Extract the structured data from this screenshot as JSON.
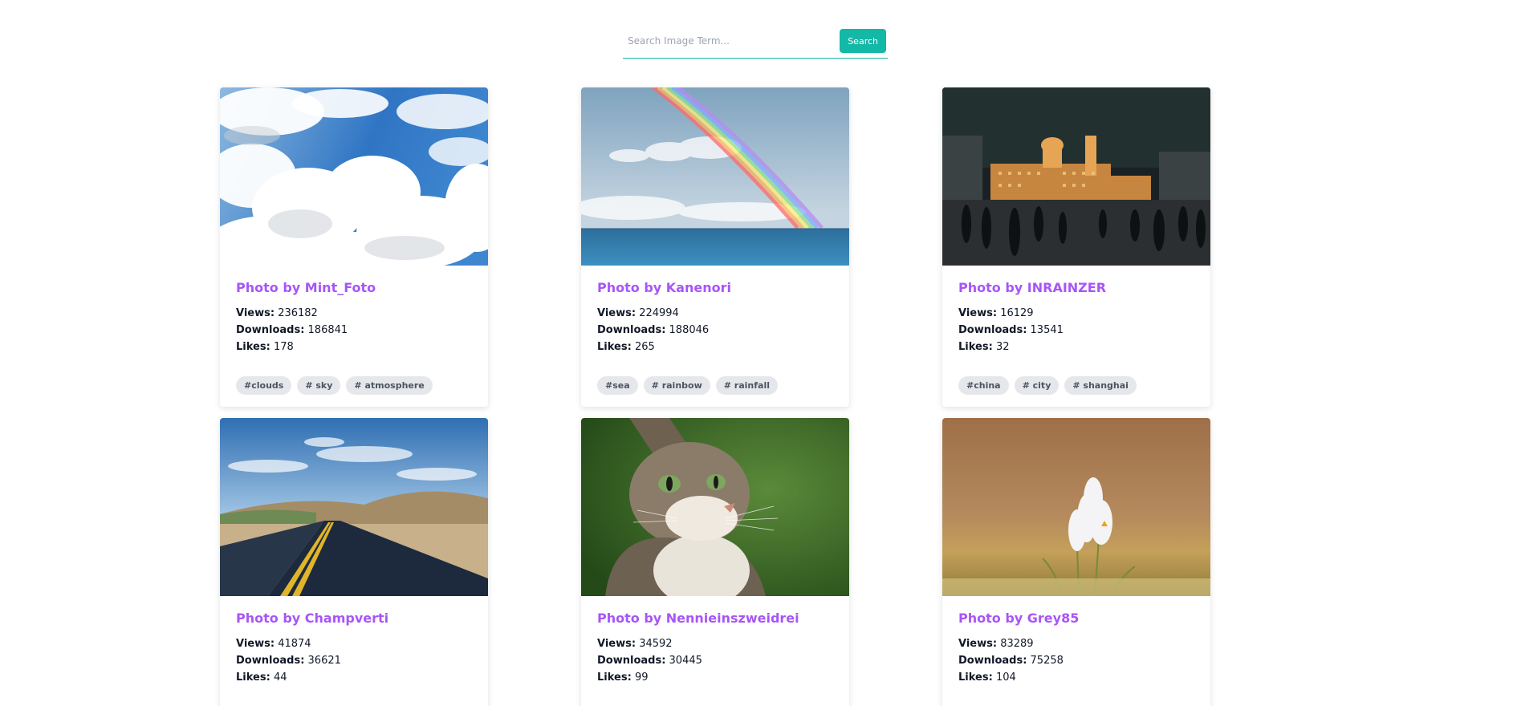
{
  "search": {
    "placeholder": "Search Image Term...",
    "button_label": "Search"
  },
  "colors": {
    "accent": "#14b8a6",
    "title": "#a855f7",
    "tag_bg": "#e5e7eb"
  },
  "stat_labels": {
    "views": "Views:",
    "downloads": "Downloads:",
    "likes": "Likes:"
  },
  "cards": [
    {
      "title": "Photo by Mint_Foto",
      "image": "clouds-sky",
      "views": "236182",
      "downloads": "186841",
      "likes": "178",
      "tags": [
        "#clouds",
        "# sky",
        "# atmosphere"
      ]
    },
    {
      "title": "Photo by Kanenori",
      "image": "sea-rainbow",
      "views": "224994",
      "downloads": "188046",
      "likes": "265",
      "tags": [
        "#sea",
        "# rainbow",
        "# rainfall"
      ]
    },
    {
      "title": "Photo by INRAINZER",
      "image": "city-night",
      "views": "16129",
      "downloads": "13541",
      "likes": "32",
      "tags": [
        "#china",
        "# city",
        "# shanghai"
      ]
    },
    {
      "title": "Photo by Champverti",
      "image": "road-hills",
      "views": "41874",
      "downloads": "36621",
      "likes": "44",
      "tags": []
    },
    {
      "title": "Photo by Nennieinszweidrei",
      "image": "cat",
      "views": "34592",
      "downloads": "30445",
      "likes": "99",
      "tags": []
    },
    {
      "title": "Photo by Grey85",
      "image": "crocus-flower",
      "views": "83289",
      "downloads": "75258",
      "likes": "104",
      "tags": []
    }
  ]
}
